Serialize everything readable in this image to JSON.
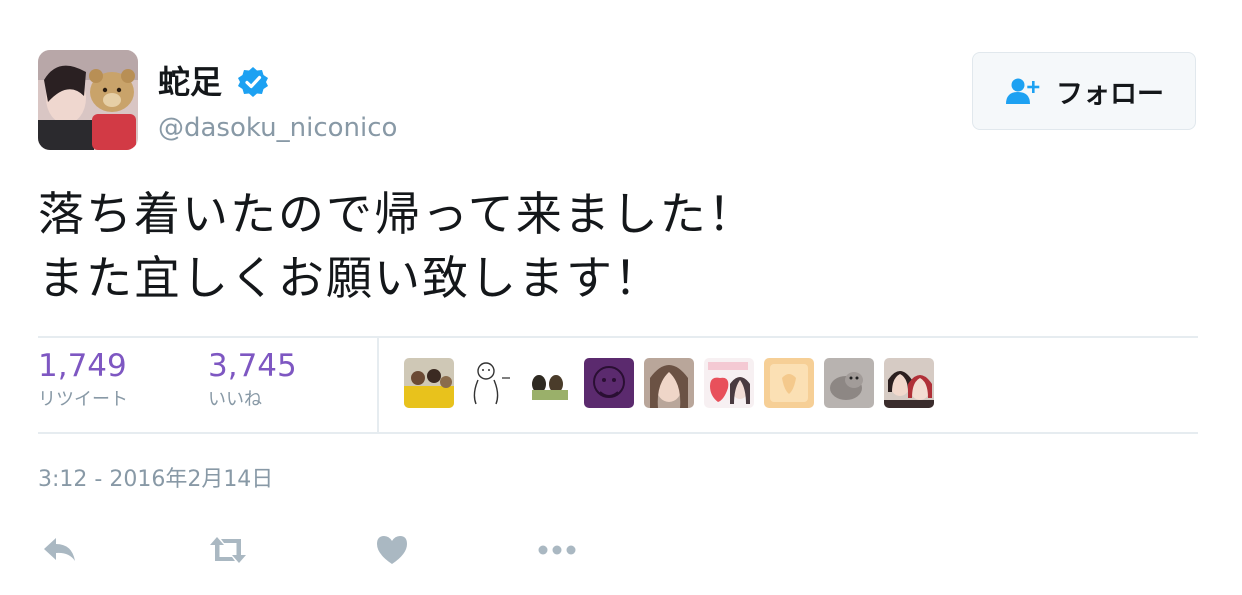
{
  "author": {
    "display_name": "蛇足",
    "handle": "@dasoku_niconico",
    "verified_icon": "verified-badge-icon",
    "avatar": "avatar"
  },
  "follow_button": {
    "label": "フォロー",
    "icon": "add-user-icon"
  },
  "tweet": {
    "lines": [
      "落ち着いたので帰って来ました！",
      "また宜しくお願い致します！"
    ],
    "timestamp": "3:12 - 2016年2月14日"
  },
  "stats": {
    "retweets": {
      "count": "1,749",
      "label": "リツイート"
    },
    "likes": {
      "count": "3,745",
      "label": "いいね"
    }
  },
  "liker_avatars": [
    "liker-avatar-1",
    "liker-avatar-2",
    "liker-avatar-3",
    "liker-avatar-4",
    "liker-avatar-5",
    "liker-avatar-6",
    "liker-avatar-7",
    "liker-avatar-8",
    "liker-avatar-9"
  ],
  "actions": [
    "reply-icon",
    "retweet-icon",
    "like-icon",
    "more-icon"
  ],
  "colors": {
    "accent_purple": "#7e57c2",
    "verified_blue": "#1da1f2",
    "muted_text": "#8899a6",
    "icon_gray": "#aab8c2",
    "border": "#e6ecf0"
  }
}
